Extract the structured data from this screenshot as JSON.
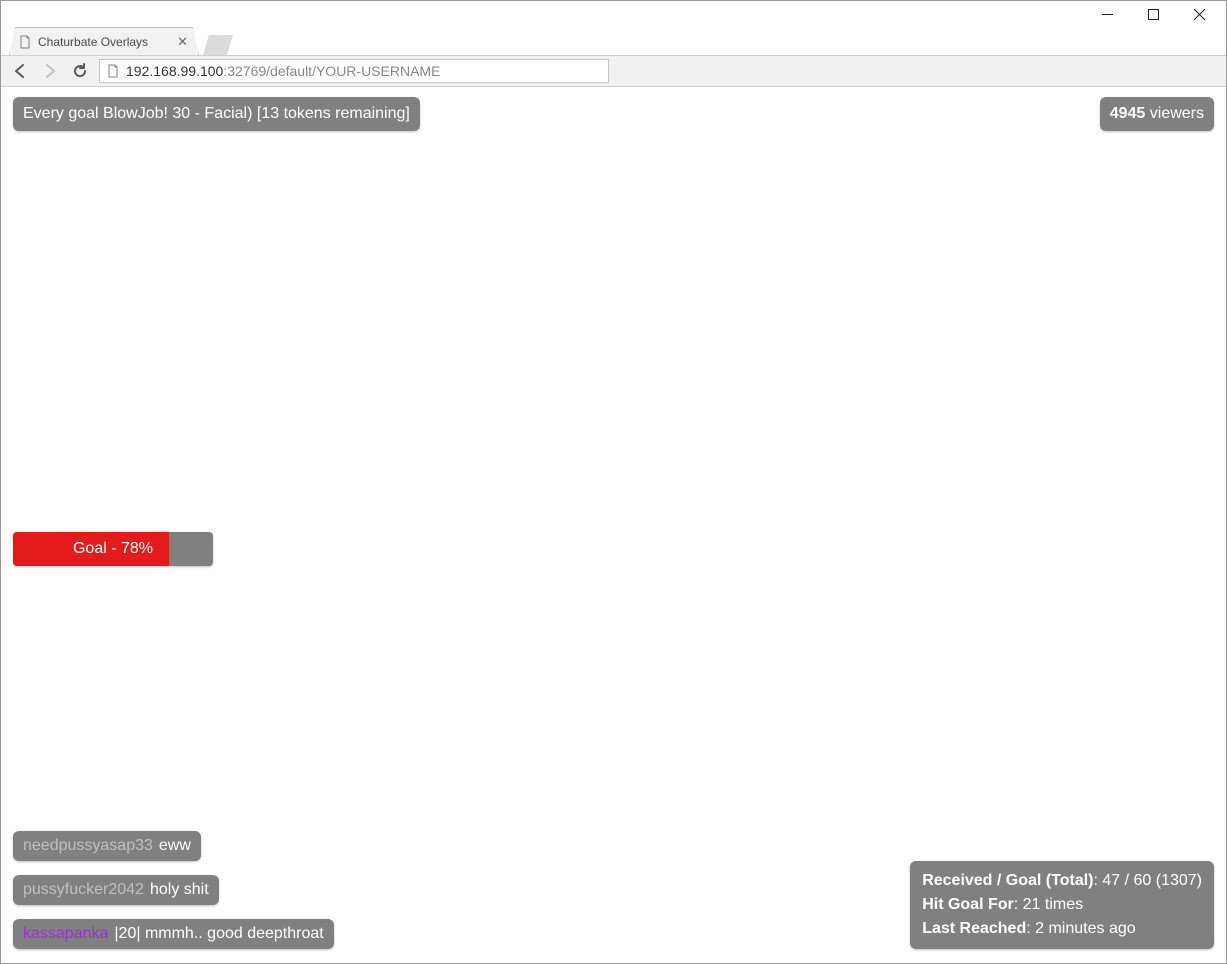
{
  "window": {
    "tab_title": "Chaturbate Overlays"
  },
  "url": {
    "host": "192.168.99.100",
    "rest": ":32769/default/YOUR-USERNAME"
  },
  "overlay": {
    "status_text": "Every goal BlowJob! 30 - Facial) [13 tokens remaining]",
    "viewers_count": "4945",
    "viewers_suffix": " viewers",
    "goal_text": "Goal - 78%",
    "goal_percent": 78
  },
  "chat": [
    {
      "user": "needpussyasap33",
      "user_style": "gray",
      "message": "eww"
    },
    {
      "user": "pussyfucker2042",
      "user_style": "gray",
      "message": "holy shit"
    },
    {
      "user": "kassapanka",
      "user_style": "purple",
      "message": "|20| mmmh.. good deepthroat"
    }
  ],
  "stats": {
    "received_label": "Received / Goal (Total)",
    "received_value": ": 47 / 60 (1307)",
    "hit_label": "Hit Goal For",
    "hit_value": ": 21 times",
    "last_label": "Last Reached",
    "last_value": ": 2 minutes ago"
  }
}
